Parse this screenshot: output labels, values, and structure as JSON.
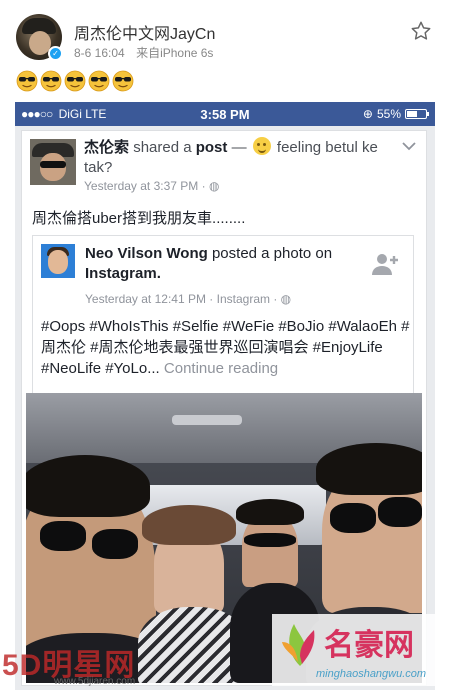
{
  "weibo": {
    "user_name": "周杰伦中文网JayCn",
    "date": "8-6 16:04",
    "source": "来自iPhone 6s",
    "emojis": [
      "cool-face-icon",
      "cool-face-icon",
      "cool-face-icon",
      "cool-face-icon",
      "cool-face-icon"
    ],
    "verified_icon": "verified-badge-icon",
    "favorite_icon": "star-icon"
  },
  "phone_status": {
    "carrier": "DiGi",
    "network": "LTE",
    "time": "3:58 PM",
    "battery": "55%",
    "battery_level": 0.55
  },
  "post": {
    "author": "杰伦索",
    "action": "shared a",
    "object": "post",
    "dash": "—",
    "feeling": "feeling betul ke tak?",
    "time": "Yesterday at 3:37 PM · ",
    "text": "周杰倫搭uber搭到我朋友車........"
  },
  "shared": {
    "author": "Neo Vilson Wong",
    "action": "posted a photo on",
    "platform": "Instagram.",
    "time": "Yesterday at 12:41 PM · Instagram · ",
    "tags": "#Oops #WhoIsThis #Selfie #WeFie #BoJio #WalaoEh #周杰伦 #周杰伦地表最强世界巡回演唱会 #EnjoyLife #NeoLife #YoLo...",
    "continue": "Continue reading"
  },
  "watermarks": {
    "left_big": "5D明星网",
    "left_small": "www.5djiaren.com",
    "right_big": "名豪网",
    "right_small": "minghaoshangwu.com"
  },
  "colors": {
    "facebook_blue": "#3b5998",
    "weibo_verified": "#1da1f2"
  }
}
